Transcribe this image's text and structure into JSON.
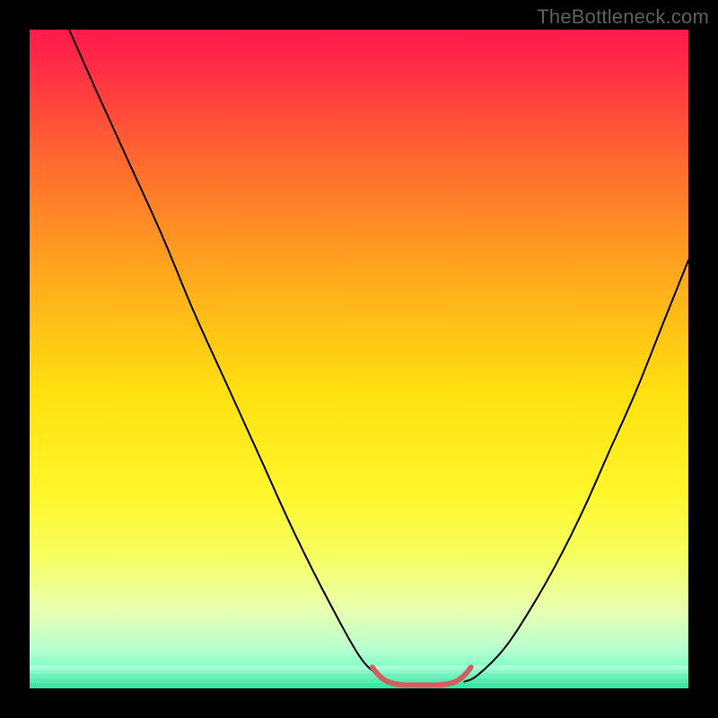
{
  "watermark": "TheBottleneck.com",
  "chart_data": {
    "type": "line",
    "title": "",
    "xlabel": "",
    "ylabel": "",
    "xlim": [
      0,
      100
    ],
    "ylim": [
      0,
      100
    ],
    "grid": false,
    "background": {
      "kind": "vertical-gradient",
      "stops": [
        {
          "pos": 0.0,
          "color": "#ff1a4b"
        },
        {
          "pos": 0.05,
          "color": "#ff2a46"
        },
        {
          "pos": 0.2,
          "color": "#ff6a2e"
        },
        {
          "pos": 0.4,
          "color": "#ffb21a"
        },
        {
          "pos": 0.55,
          "color": "#ffe010"
        },
        {
          "pos": 0.7,
          "color": "#fff62a"
        },
        {
          "pos": 0.8,
          "color": "#f6ff60"
        },
        {
          "pos": 0.88,
          "color": "#e9ffb0"
        },
        {
          "pos": 0.94,
          "color": "#b8ffd0"
        },
        {
          "pos": 0.97,
          "color": "#7dffc6"
        },
        {
          "pos": 1.0,
          "color": "#2dff9e"
        }
      ]
    },
    "series": [
      {
        "name": "curve-left",
        "stroke": "#000000",
        "stroke_width": 2,
        "x": [
          6,
          10,
          15,
          20,
          25,
          30,
          35,
          40,
          45,
          50,
          53,
          55
        ],
        "y": [
          100,
          91,
          80,
          69,
          57,
          46,
          35,
          24,
          14,
          5,
          2,
          1
        ]
      },
      {
        "name": "curve-right",
        "stroke": "#000000",
        "stroke_width": 2,
        "x": [
          66,
          68,
          72,
          76,
          80,
          84,
          88,
          92,
          96,
          100
        ],
        "y": [
          1,
          2,
          6,
          12,
          19,
          27,
          36,
          45,
          55,
          65
        ]
      },
      {
        "name": "bottom-plateau",
        "stroke": "#d06060",
        "stroke_width": 6,
        "x": [
          52,
          53,
          54,
          55,
          56,
          57,
          58,
          59,
          60,
          61,
          62,
          63,
          64,
          65,
          66,
          67
        ],
        "y": [
          3.2,
          2.0,
          1.2,
          0.8,
          0.6,
          0.5,
          0.5,
          0.5,
          0.5,
          0.5,
          0.5,
          0.6,
          0.8,
          1.2,
          2.0,
          3.2
        ]
      }
    ]
  }
}
